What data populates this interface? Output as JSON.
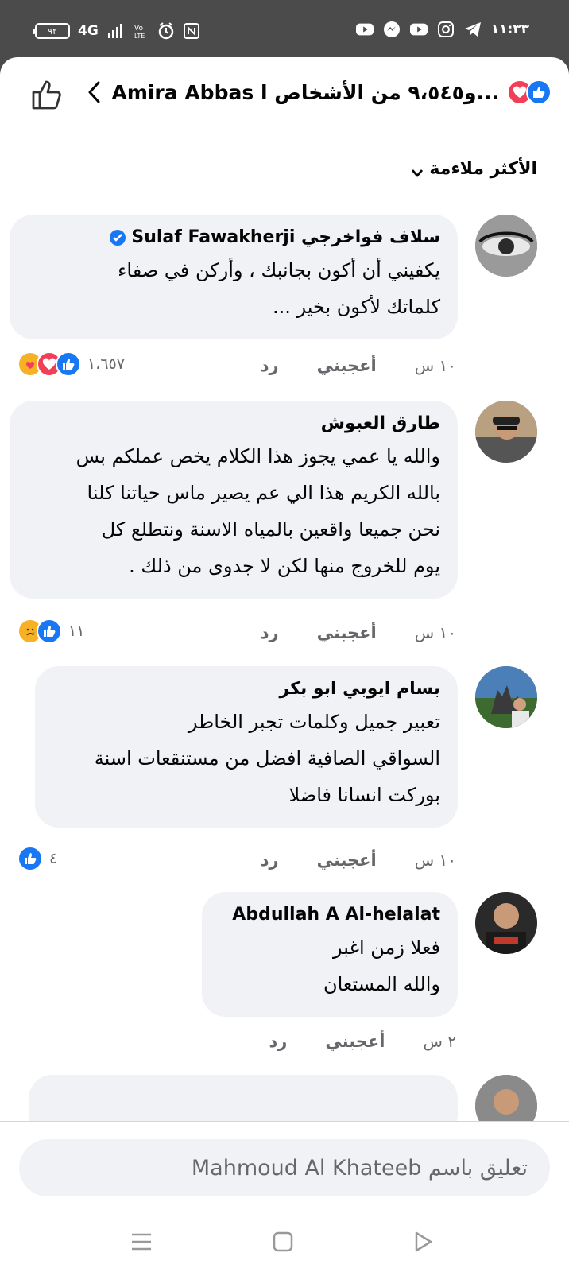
{
  "status_bar": {
    "battery": "٩٢",
    "network": "4G",
    "time": "١١:٣٣",
    "icons": [
      "battery-icon",
      "signal-icon",
      "volte-icon",
      "alarm-icon",
      "nfc-icon",
      "youtube-icon",
      "messenger-icon",
      "youtube-icon",
      "instagram-icon",
      "telegram-icon"
    ]
  },
  "header": {
    "title": "Amira Abbas و٩،٥٤٥ من الأشخاص ا...",
    "reactions": [
      "like",
      "love"
    ]
  },
  "sort": {
    "label": "الأكثر ملاءمة"
  },
  "comments": [
    {
      "name": "سلاف فواخرجي Sulaf Fawakherji",
      "verified": true,
      "text": "يكفيني أن أكون بجانبك ، وأركن في صفاء\nكلماتك لأكون بخير ...",
      "time": "١٠ س",
      "like_label": "أعجبني",
      "reply_label": "رد",
      "reaction_count": "١،٦٥٧",
      "reactions": [
        "like",
        "love",
        "care"
      ]
    },
    {
      "name": "طارق العبوش",
      "verified": false,
      "text": "والله يا عمي يجوز هذا الكلام يخص عملكم بس\nبالله الكريم هذا الي عم يصير ماس حياتنا كلنا\nنحن جميعا واقعين بالمياه الاسنة ونتطلع كل\nيوم للخروج منها لكن لا جدوى من ذلك .",
      "time": "١٠ س",
      "like_label": "أعجبني",
      "reply_label": "رد",
      "reaction_count": "١١",
      "reactions": [
        "like",
        "sad"
      ]
    },
    {
      "name": "بسام ايوبي ابو بكر",
      "verified": false,
      "text": "تعبير جميل وكلمات تجبر الخاطر\nالسواقي الصافية افضل من مستنقعات اسنة\nبوركت انسانا فاضلا",
      "time": "١٠ س",
      "like_label": "أعجبني",
      "reply_label": "رد",
      "reaction_count": "٤",
      "reactions": [
        "like"
      ]
    },
    {
      "name": "Abdullah A Al-helalat",
      "verified": false,
      "text": "فعلا زمن اغبر\nوالله المستعان",
      "time": "٢ س",
      "like_label": "أعجبني",
      "reply_label": "رد",
      "reaction_count": "",
      "reactions": []
    }
  ],
  "composer": {
    "placeholder": "تعليق باسم Mahmoud Al Khateeb"
  },
  "navbar": {
    "icons": [
      "menu-icon",
      "home-icon",
      "back-icon"
    ]
  },
  "colors": {
    "like": "#1877f2",
    "love": "#f33e58",
    "care": "#f7b125",
    "bubble": "#f0f2f5",
    "meta": "#65676b"
  }
}
